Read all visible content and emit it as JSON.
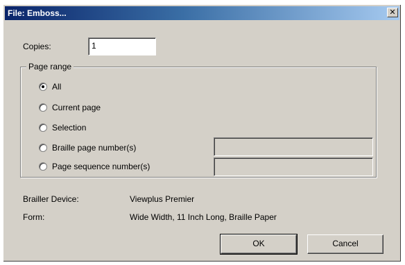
{
  "window": {
    "title": "File: Emboss...",
    "close_glyph": "✕"
  },
  "copies": {
    "label": "Copies:",
    "value": "1"
  },
  "page_range": {
    "legend": "Page range",
    "options": [
      {
        "label": "All",
        "checked": true
      },
      {
        "label": "Current page",
        "checked": false
      },
      {
        "label": "Selection",
        "checked": false
      },
      {
        "label": "Braille page number(s)",
        "checked": false
      },
      {
        "label": "Page sequence number(s)",
        "checked": false
      }
    ]
  },
  "info": {
    "device_label": "Brailler Device:",
    "device_value": "Viewplus Premier",
    "form_label": "Form:",
    "form_value": "Wide Width, 11 Inch Long, Braille Paper"
  },
  "buttons": {
    "ok": "OK",
    "cancel": "Cancel"
  }
}
